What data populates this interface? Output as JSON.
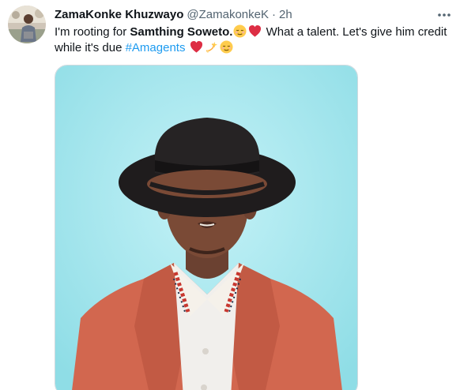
{
  "tweet": {
    "display_name": "ZamaKonke Khuzwayo",
    "handle": "@ZamakonkeK",
    "separator": "·",
    "timestamp": "2h",
    "text": {
      "part1": "I'm rooting for ",
      "bold_name": "Samthing Soweto.",
      "part2": " What a talent. Let's give him credit while it's due ",
      "hashtag": "#Amagents"
    },
    "emojis": [
      "relieved-face",
      "red-heart",
      "red-heart",
      "dizzy",
      "relieved-face"
    ],
    "more_icon": "more-horizontal-icon"
  },
  "colors": {
    "handle_gray": "#536471",
    "link_blue": "#1d9bf0",
    "photo_background": "#a8e6ee",
    "jacket": "#d2674f"
  }
}
